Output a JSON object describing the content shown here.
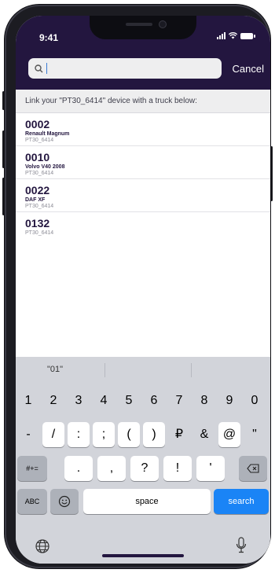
{
  "status": {
    "time": "9:41"
  },
  "search": {
    "placeholder": "",
    "cancel_label": "Cancel"
  },
  "header": {
    "text": "Link your \"PT30_6414\" device with a truck below:"
  },
  "trucks": [
    {
      "code": "0002",
      "name": "Renault Magnum",
      "device": "PT30_6414"
    },
    {
      "code": "0010",
      "name": "Volvo V40 2008",
      "device": "PT30_6414"
    },
    {
      "code": "0022",
      "name": "DAF XF",
      "device": "PT30_6414"
    },
    {
      "code": "0132",
      "name": "",
      "device": "PT30_6414"
    }
  ],
  "keyboard": {
    "suggestion": "\"01\"",
    "row1": [
      "1",
      "2",
      "3",
      "4",
      "5",
      "6",
      "7",
      "8",
      "9",
      "0"
    ],
    "row2": [
      "-",
      "/",
      ":",
      ";",
      "(",
      ")",
      "₽",
      "&",
      "@",
      "\""
    ],
    "row3": [
      ".",
      ",",
      "?",
      "!",
      "'"
    ],
    "shift_label": "#+=",
    "abc_label": "ABC",
    "space_label": "space",
    "search_label": "search"
  },
  "colors": {
    "header_bg": "#23163f",
    "accent": "#1a84f6",
    "text_dark": "#23163f"
  }
}
